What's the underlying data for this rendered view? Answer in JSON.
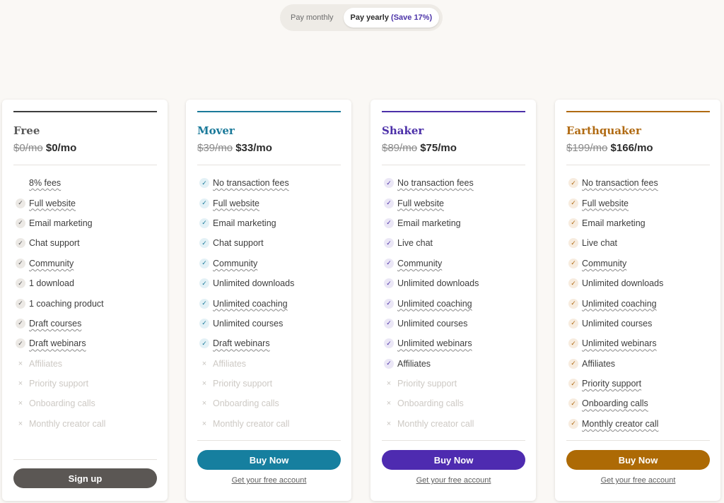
{
  "toggle": {
    "monthly_label": "Pay monthly",
    "yearly_label": "Pay yearly",
    "yearly_save": "(Save 17%)"
  },
  "plans": [
    {
      "name": "Free",
      "accent": "#3d3d3d",
      "name_color": "#5a5a5a",
      "check_bg": "#ece9e5",
      "check_color": "#555555",
      "old_price": "$0/mo",
      "new_price": "$0/mo",
      "features": [
        {
          "label": "8% fees",
          "icon": "none",
          "underline": true,
          "enabled": true
        },
        {
          "label": "Full website",
          "icon": "check",
          "underline": true,
          "enabled": true
        },
        {
          "label": "Email marketing",
          "icon": "check",
          "underline": false,
          "enabled": true
        },
        {
          "label": "Chat support",
          "icon": "check",
          "underline": false,
          "enabled": true
        },
        {
          "label": "Community",
          "icon": "check",
          "underline": true,
          "enabled": true
        },
        {
          "label": "1 download",
          "icon": "check",
          "underline": false,
          "enabled": true
        },
        {
          "label": "1 coaching product",
          "icon": "check",
          "underline": false,
          "enabled": true
        },
        {
          "label": "Draft courses",
          "icon": "check",
          "underline": true,
          "enabled": true
        },
        {
          "label": "Draft webinars",
          "icon": "check",
          "underline": true,
          "enabled": true
        },
        {
          "label": "Affiliates",
          "icon": "cross",
          "underline": false,
          "enabled": false
        },
        {
          "label": "Priority support",
          "icon": "cross",
          "underline": false,
          "enabled": false
        },
        {
          "label": "Onboarding calls",
          "icon": "cross",
          "underline": false,
          "enabled": false
        },
        {
          "label": "Monthly creator call",
          "icon": "cross",
          "underline": false,
          "enabled": false
        }
      ],
      "cta": "Sign up",
      "cta_color": "#5b5754",
      "free_link": ""
    },
    {
      "name": "Mover",
      "accent": "#1b7a9a",
      "name_color": "#1b7a9a",
      "check_bg": "#e3f1f6",
      "check_color": "#1b7a9a",
      "old_price": "$39/mo",
      "new_price": "$33/mo",
      "features": [
        {
          "label": "No transaction fees",
          "icon": "check",
          "underline": true,
          "enabled": true
        },
        {
          "label": "Full website",
          "icon": "check",
          "underline": true,
          "enabled": true
        },
        {
          "label": "Email marketing",
          "icon": "check",
          "underline": false,
          "enabled": true
        },
        {
          "label": "Chat support",
          "icon": "check",
          "underline": false,
          "enabled": true
        },
        {
          "label": "Community",
          "icon": "check",
          "underline": true,
          "enabled": true
        },
        {
          "label": "Unlimited downloads",
          "icon": "check",
          "underline": false,
          "enabled": true
        },
        {
          "label": "Unlimited coaching",
          "icon": "check",
          "underline": true,
          "enabled": true
        },
        {
          "label": "Unlimited courses",
          "icon": "check",
          "underline": false,
          "enabled": true
        },
        {
          "label": "Draft webinars",
          "icon": "check",
          "underline": true,
          "enabled": true
        },
        {
          "label": "Affiliates",
          "icon": "cross",
          "underline": false,
          "enabled": false
        },
        {
          "label": "Priority support",
          "icon": "cross",
          "underline": false,
          "enabled": false
        },
        {
          "label": "Onboarding calls",
          "icon": "cross",
          "underline": false,
          "enabled": false
        },
        {
          "label": "Monthly creator call",
          "icon": "cross",
          "underline": false,
          "enabled": false
        }
      ],
      "cta": "Buy Now",
      "cta_color": "#167f9f",
      "free_link": "Get your free account"
    },
    {
      "name": "Shaker",
      "accent": "#4b2fa8",
      "name_color": "#4b2fa8",
      "check_bg": "#ebe7f6",
      "check_color": "#4b2fa8",
      "old_price": "$89/mo",
      "new_price": "$75/mo",
      "features": [
        {
          "label": "No transaction fees",
          "icon": "check",
          "underline": true,
          "enabled": true
        },
        {
          "label": "Full website",
          "icon": "check",
          "underline": true,
          "enabled": true
        },
        {
          "label": "Email marketing",
          "icon": "check",
          "underline": false,
          "enabled": true
        },
        {
          "label": "Live chat",
          "icon": "check",
          "underline": false,
          "enabled": true
        },
        {
          "label": "Community",
          "icon": "check",
          "underline": true,
          "enabled": true
        },
        {
          "label": "Unlimited downloads",
          "icon": "check",
          "underline": false,
          "enabled": true
        },
        {
          "label": "Unlimited coaching",
          "icon": "check",
          "underline": true,
          "enabled": true
        },
        {
          "label": "Unlimited courses",
          "icon": "check",
          "underline": false,
          "enabled": true
        },
        {
          "label": "Unlimited webinars",
          "icon": "check",
          "underline": true,
          "enabled": true
        },
        {
          "label": "Affiliates",
          "icon": "check",
          "underline": false,
          "enabled": true
        },
        {
          "label": "Priority support",
          "icon": "cross",
          "underline": false,
          "enabled": false
        },
        {
          "label": "Onboarding calls",
          "icon": "cross",
          "underline": false,
          "enabled": false
        },
        {
          "label": "Monthly creator call",
          "icon": "cross",
          "underline": false,
          "enabled": false
        }
      ],
      "cta": "Buy Now",
      "cta_color": "#4e2bb0",
      "free_link": "Get your free account"
    },
    {
      "name": "Earthquaker",
      "accent": "#b06a12",
      "name_color": "#b06a12",
      "check_bg": "#f7ecdf",
      "check_color": "#b06a12",
      "old_price": "$199/mo",
      "new_price": "$166/mo",
      "features": [
        {
          "label": "No transaction fees",
          "icon": "check",
          "underline": true,
          "enabled": true
        },
        {
          "label": "Full website",
          "icon": "check",
          "underline": true,
          "enabled": true
        },
        {
          "label": "Email marketing",
          "icon": "check",
          "underline": false,
          "enabled": true
        },
        {
          "label": "Live chat",
          "icon": "check",
          "underline": false,
          "enabled": true
        },
        {
          "label": "Community",
          "icon": "check",
          "underline": true,
          "enabled": true
        },
        {
          "label": "Unlimited downloads",
          "icon": "check",
          "underline": false,
          "enabled": true
        },
        {
          "label": "Unlimited coaching",
          "icon": "check",
          "underline": true,
          "enabled": true
        },
        {
          "label": "Unlimited courses",
          "icon": "check",
          "underline": false,
          "enabled": true
        },
        {
          "label": "Unlimited webinars",
          "icon": "check",
          "underline": true,
          "enabled": true
        },
        {
          "label": "Affiliates",
          "icon": "check",
          "underline": false,
          "enabled": true
        },
        {
          "label": "Priority support",
          "icon": "check",
          "underline": true,
          "enabled": true
        },
        {
          "label": "Onboarding calls",
          "icon": "check",
          "underline": true,
          "enabled": true
        },
        {
          "label": "Monthly creator call",
          "icon": "check",
          "underline": true,
          "enabled": true
        }
      ],
      "cta": "Buy Now",
      "cta_color": "#ad6a05",
      "free_link": "Get your free account"
    }
  ]
}
